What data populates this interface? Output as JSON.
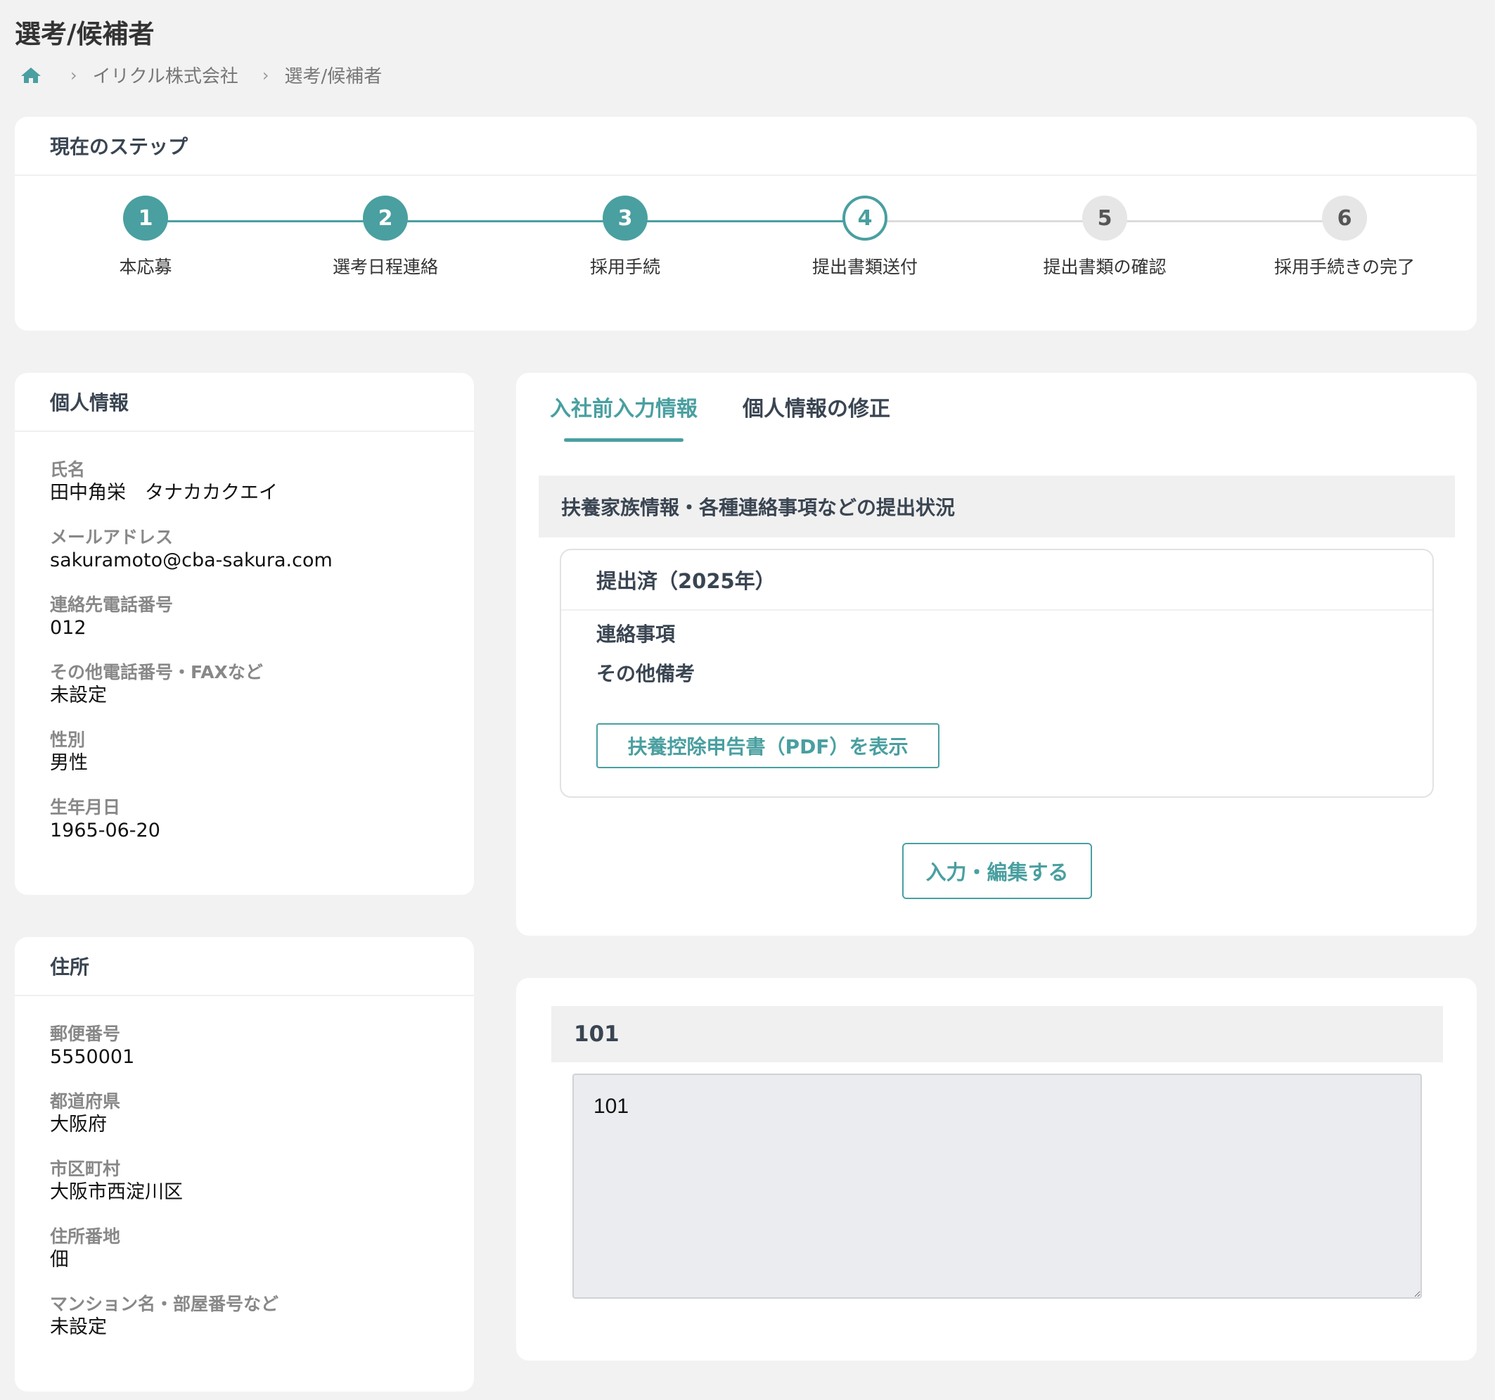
{
  "page": {
    "title": "選考/候補者"
  },
  "breadcrumb": {
    "home_icon": "home-icon",
    "items": [
      "イリクル株式会社",
      "選考/候補者"
    ]
  },
  "steps_card": {
    "title": "現在のステップ",
    "current_step": 4,
    "steps": [
      {
        "number": "1",
        "label": "本応募",
        "state": "done"
      },
      {
        "number": "2",
        "label": "選考日程連絡",
        "state": "done"
      },
      {
        "number": "3",
        "label": "採用手続",
        "state": "done"
      },
      {
        "number": "4",
        "label": "提出書類送付",
        "state": "current"
      },
      {
        "number": "5",
        "label": "提出書類の確認",
        "state": "todo"
      },
      {
        "number": "6",
        "label": "採用手続きの完了",
        "state": "todo"
      }
    ]
  },
  "personal_info": {
    "title": "個人情報",
    "fields": [
      {
        "label": "氏名",
        "value": "田中角栄　タナカカクエイ"
      },
      {
        "label": "メールアドレス",
        "value": "sakuramoto@cba-sakura.com"
      },
      {
        "label": "連絡先電話番号",
        "value": "012"
      },
      {
        "label": "その他電話番号・FAXなど",
        "value": "未設定"
      },
      {
        "label": "性別",
        "value": "男性"
      },
      {
        "label": "生年月日",
        "value": "1965-06-20"
      }
    ]
  },
  "address": {
    "title": "住所",
    "fields": [
      {
        "label": "郵便番号",
        "value": "5550001"
      },
      {
        "label": "都道府県",
        "value": "大阪府"
      },
      {
        "label": "市区町村",
        "value": "大阪市西淀川区"
      },
      {
        "label": "住所番地",
        "value": "佃"
      },
      {
        "label": "マンション名・部屋番号など",
        "value": "未設定"
      }
    ]
  },
  "tabs_card": {
    "tabs": [
      {
        "label": "入社前入力情報",
        "active": true
      },
      {
        "label": "個人情報の修正",
        "active": false
      }
    ],
    "section_title": "扶養家族情報・各種連絡事項などの提出状況",
    "submission": {
      "status": "提出済（2025年）",
      "items": [
        "連絡事項",
        "その他備考"
      ],
      "pdf_button": "扶養控除申告書（PDF）を表示"
    },
    "edit_button": "入力・編集する"
  },
  "memo_card": {
    "title": "101",
    "value": "101"
  },
  "colors": {
    "accent": "#4a9fa0",
    "background": "#f2f2f2",
    "card": "#ffffff"
  }
}
